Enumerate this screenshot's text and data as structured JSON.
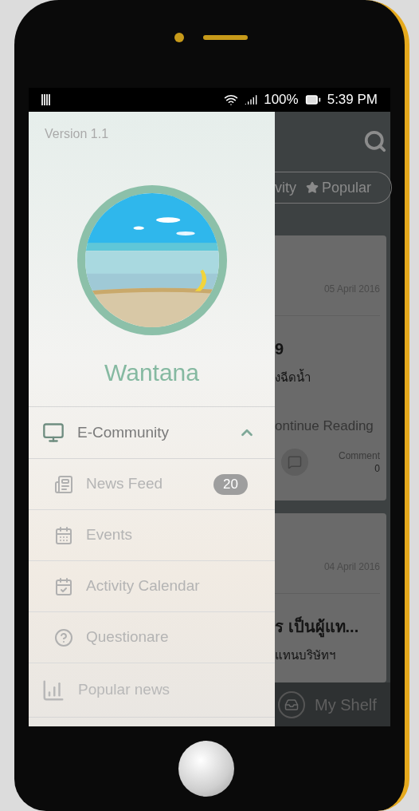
{
  "status_bar": {
    "battery": "100%",
    "time": "5:39 PM"
  },
  "drawer": {
    "version": "Version 1.1",
    "user_name": "Wantana",
    "menu": [
      {
        "label": "E-Community",
        "kind": "group",
        "expanded": true,
        "children": [
          {
            "label": "News Feed",
            "badge": "20"
          },
          {
            "label": "Events"
          },
          {
            "label": "Activity Calendar"
          },
          {
            "label": "Questionare"
          }
        ]
      },
      {
        "label": "Popular news",
        "kind": "item"
      }
    ]
  },
  "feed": {
    "tabs": [
      {
        "label": "vity"
      },
      {
        "label": "Popular"
      }
    ],
    "cards": [
      {
        "date": "05 April 2016",
        "title": "9",
        "excerpt": "งฉีดน้ำ",
        "link": "ontinue Reading",
        "comment_label": "Comment",
        "comment_count": "0"
      },
      {
        "date": "04 April 2016",
        "title": "ร เป็นผู้แท...",
        "excerpt": "แทนบริษัทฯ"
      }
    ],
    "bottom_bar": {
      "label": "My Shelf"
    }
  }
}
